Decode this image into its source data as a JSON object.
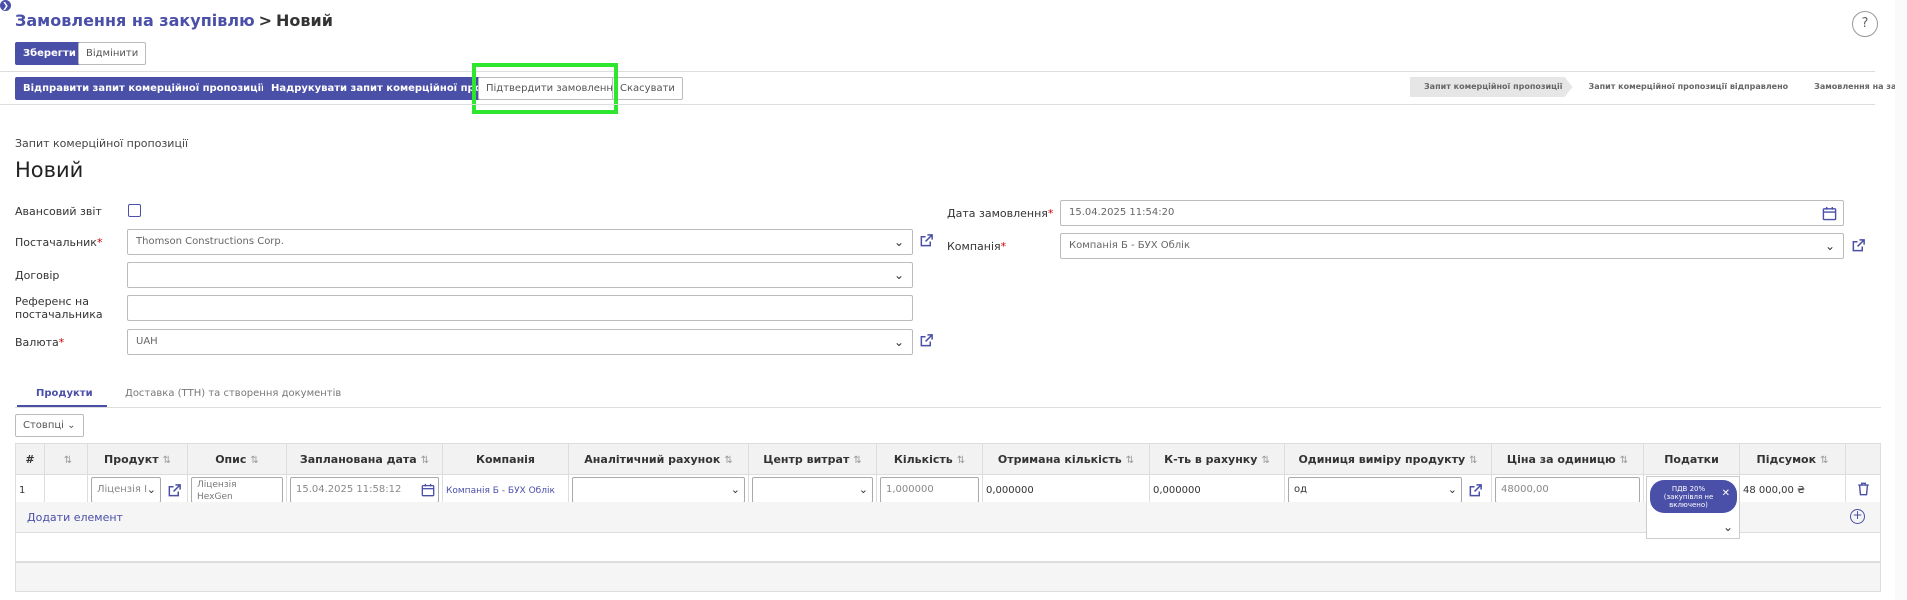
{
  "breadcrumb": {
    "parent": "Замовлення на закупівлю",
    "separator": ">",
    "current": "Новий"
  },
  "help_label": "?",
  "toolbar": {
    "save": "Зберегти",
    "discard": "Відмінити"
  },
  "actions": {
    "send_email": "Відправити запит комерційної пропозиції на Email",
    "print_rfq": "Надрукувати запит комерційної пропозиції",
    "confirm_order": "Підтвердити замовлення",
    "cancel": "Скасувати"
  },
  "stages": [
    "Запит комерційної пропозиції",
    "Запит комерційної пропозиції відправлено",
    "Замовлення на закупівлю"
  ],
  "record": {
    "subtitle": "Запит комерційної пропозиції",
    "title": "Новий"
  },
  "form": {
    "advance_report": {
      "label": "Авансовий звіт",
      "checked": false
    },
    "supplier": {
      "label": "Постачальник",
      "required": "*",
      "value": "Thomson Constructions Corp."
    },
    "contract": {
      "label": "Договір",
      "value": ""
    },
    "supplier_ref": {
      "label_line1": "Референс на",
      "label_line2": "постачальника",
      "value": ""
    },
    "currency": {
      "label": "Валюта",
      "required": "*",
      "value": "UAH"
    },
    "order_date": {
      "label": "Дата замовлення",
      "required": "*",
      "value": "15.04.2025 11:54:20"
    },
    "company": {
      "label": "Компанія",
      "required": "*",
      "value": "Компанія Б - БУХ Облік"
    }
  },
  "tabs": {
    "products": "Продукти",
    "delivery": "Доставка (ТТН) та створення документів"
  },
  "columns_button": "Стовпці",
  "table": {
    "headers": [
      "#",
      "",
      "Продукт",
      "Опис",
      "Запланована дата",
      "Компанія",
      "Аналітичний рахунок",
      "Центр витрат",
      "Кількість",
      "Отримана кількість",
      "К-ть в рахунку",
      "Одиниця виміру продукту",
      "Ціна за одиницю",
      "Податки",
      "Підсумок",
      ""
    ],
    "row": {
      "num": "1",
      "product": "Ліцензія I",
      "description_line1": "Ліцензія",
      "description_line2": "HexGen",
      "planned_date": "15.04.2025 11:58:12",
      "company": "Компанія Б - БУХ Облік",
      "analytic": "",
      "cost_center": "",
      "quantity": "1,000000",
      "received": "0,000000",
      "invoiced": "0,000000",
      "uom": "од",
      "unit_price": "48000,00",
      "tax_chip_line1": "ПДВ 20%",
      "tax_chip_line2": "(закупівля не",
      "tax_chip_line3": "включено)",
      "subtotal": "48 000,00 ₴"
    },
    "add_line": "Додати елемент"
  },
  "colors": {
    "accent": "#4a4fa8",
    "highlight": "#2ee62e",
    "required": "#cc0000"
  }
}
